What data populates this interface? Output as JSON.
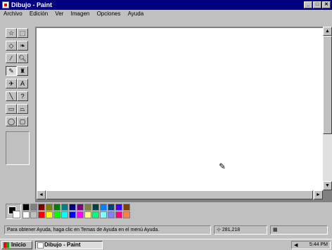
{
  "window": {
    "title": "Dibujo - Paint"
  },
  "menu": [
    "Archivo",
    "Edición",
    "Ver",
    "Imagen",
    "Opciones",
    "Ayuda"
  ],
  "tools": [
    {
      "name": "free-select-icon",
      "glyph": "☆"
    },
    {
      "name": "rect-select-icon",
      "glyph": "⬚"
    },
    {
      "name": "eraser-icon",
      "glyph": "◇"
    },
    {
      "name": "fill-icon",
      "glyph": "❧"
    },
    {
      "name": "eyedropper-icon",
      "glyph": "⁄"
    },
    {
      "name": "magnifier-icon",
      "glyph": "🔍︎"
    },
    {
      "name": "pencil-icon",
      "glyph": "✎"
    },
    {
      "name": "brush-icon",
      "glyph": "♜"
    },
    {
      "name": "airbrush-icon",
      "glyph": "✈"
    },
    {
      "name": "text-icon",
      "glyph": "A"
    },
    {
      "name": "line-icon",
      "glyph": "╲"
    },
    {
      "name": "curve-icon",
      "glyph": "?"
    },
    {
      "name": "rectangle-icon",
      "glyph": "▭"
    },
    {
      "name": "polygon-icon",
      "glyph": "⏢"
    },
    {
      "name": "ellipse-icon",
      "glyph": "◯"
    },
    {
      "name": "rounded-rect-icon",
      "glyph": "▢"
    }
  ],
  "palette": {
    "foreground": "#000000",
    "background": "#ffffff",
    "colors": [
      "#000000",
      "#808080",
      "#800000",
      "#808000",
      "#008000",
      "#008080",
      "#000080",
      "#800080",
      "#808040",
      "#004040",
      "#0080ff",
      "#004080",
      "#4000ff",
      "#804000",
      "#ffffff",
      "#c0c0c0",
      "#ff0000",
      "#ffff00",
      "#00ff00",
      "#00ffff",
      "#0000ff",
      "#ff00ff",
      "#ffff80",
      "#00ff80",
      "#80ffff",
      "#8080ff",
      "#ff0080",
      "#ff8040"
    ]
  },
  "status": {
    "help_text": "Para obtener Ayuda, haga clic en Temas de Ayuda en el menú Ayuda.",
    "coords": "281,218"
  },
  "taskbar": {
    "start_label": "Inicio",
    "task_label": "Dibujo - Paint",
    "clock": "5:44 PM"
  }
}
